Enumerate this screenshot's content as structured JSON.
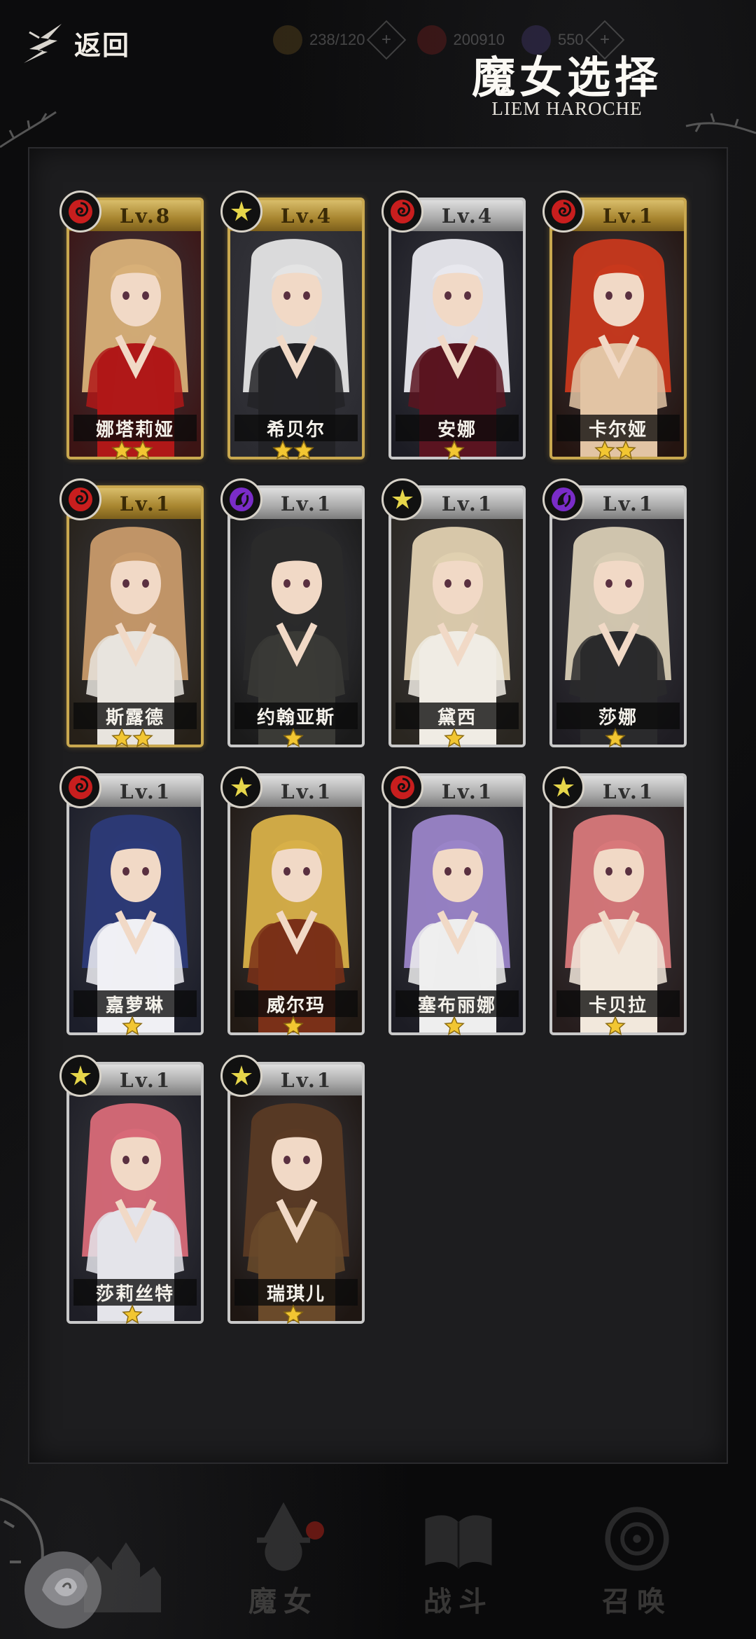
{
  "header": {
    "back_label": "返回",
    "title": "魔女选择",
    "subtitle": "LIEM HAROCHE",
    "resources": [
      {
        "icon": "card-icon",
        "value": "238/120",
        "color": "#b88a3a"
      },
      {
        "icon": "crystal-icon",
        "value": "200910",
        "color": "#b02828"
      },
      {
        "icon": "orb-icon",
        "value": "550",
        "color": "#6c5aa8"
      }
    ]
  },
  "cards": [
    {
      "name": "娜塔莉娅",
      "level": "Lv.8",
      "element": "fire",
      "rarity": "gold",
      "stars": 2,
      "hair": "#d8b078",
      "outfit": "#b01818",
      "bg": "#3c1414"
    },
    {
      "name": "希贝尔",
      "level": "Lv.4",
      "element": "light",
      "rarity": "gold",
      "stars": 2,
      "hair": "#e4e4e4",
      "outfit": "#222226",
      "bg": "#2a2a30"
    },
    {
      "name": "安娜",
      "level": "Lv.4",
      "element": "fire",
      "rarity": "silver",
      "stars": 1,
      "hair": "#e8e8ee",
      "outfit": "#5a1420",
      "bg": "#1c1c24"
    },
    {
      "name": "卡尔娅",
      "level": "Lv.1",
      "element": "fire",
      "rarity": "gold",
      "stars": 2,
      "hair": "#c8381c",
      "outfit": "#e2c4a4",
      "bg": "#241410"
    },
    {
      "name": "斯露德",
      "level": "Lv.1",
      "element": "fire",
      "rarity": "gold",
      "stars": 2,
      "hair": "#c89a6a",
      "outfit": "#e8e4de",
      "bg": "#262018"
    },
    {
      "name": "约翰亚斯",
      "level": "Lv.1",
      "element": "dark",
      "rarity": "silver",
      "stars": 1,
      "hair": "#2a2a2a",
      "outfit": "#3a3a36",
      "bg": "#1a1a1a"
    },
    {
      "name": "黛西",
      "level": "Lv.1",
      "element": "light",
      "rarity": "silver",
      "stars": 1,
      "hair": "#e0d0b0",
      "outfit": "#f0ece4",
      "bg": "#2a2620"
    },
    {
      "name": "莎娜",
      "level": "Lv.1",
      "element": "dark",
      "rarity": "silver",
      "stars": 1,
      "hair": "#d8ccb4",
      "outfit": "#2a2a2c",
      "bg": "#1e1c22"
    },
    {
      "name": "嘉萝琳",
      "level": "Lv.1",
      "element": "fire",
      "rarity": "silver",
      "stars": 1,
      "hair": "#2c3a78",
      "outfit": "#f0f0f4",
      "bg": "#1c1e2a"
    },
    {
      "name": "威尔玛",
      "level": "Lv.1",
      "element": "light",
      "rarity": "silver",
      "stars": 1,
      "hair": "#d8b048",
      "outfit": "#7a3018",
      "bg": "#221a14"
    },
    {
      "name": "塞布丽娜",
      "level": "Lv.1",
      "element": "fire",
      "rarity": "silver",
      "stars": 1,
      "hair": "#9a84c8",
      "outfit": "#eeeeee",
      "bg": "#1c1c24"
    },
    {
      "name": "卡贝拉",
      "level": "Lv.1",
      "element": "light",
      "rarity": "silver",
      "stars": 1,
      "hair": "#d8787a",
      "outfit": "#f2e8dc",
      "bg": "#261c1c"
    },
    {
      "name": "莎莉丝特",
      "level": "Lv.1",
      "element": "light",
      "rarity": "silver",
      "stars": 1,
      "hair": "#d86a78",
      "outfit": "#e4e4ea",
      "bg": "#1e1e26"
    },
    {
      "name": "瑞琪儿",
      "level": "Lv.1",
      "element": "light",
      "rarity": "silver",
      "stars": 1,
      "hair": "#5a3a24",
      "outfit": "#6a4a2a",
      "bg": "#1e1612"
    }
  ],
  "element_colors": {
    "fire": "#c81e1e",
    "light": "#e6d64a",
    "dark": "#7a2cc8"
  },
  "nav": [
    {
      "label": "",
      "icon": "castle-icon"
    },
    {
      "label": "魔女",
      "icon": "witch-icon",
      "badge": true
    },
    {
      "label": "战斗",
      "icon": "book-icon"
    },
    {
      "label": "召唤",
      "icon": "summon-icon"
    }
  ]
}
